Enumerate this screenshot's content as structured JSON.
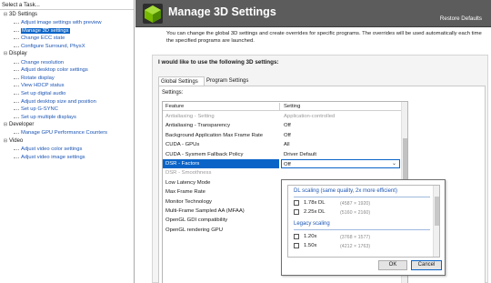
{
  "left_pane": {
    "title": "Select a Task...",
    "categories": [
      {
        "label": "3D Settings",
        "items": [
          {
            "label": "Adjust image settings with preview"
          },
          {
            "label": "Manage 3D settings",
            "selected": true
          },
          {
            "label": "Change ECC state"
          },
          {
            "label": "Configure Surround, PhysX"
          }
        ]
      },
      {
        "label": "Display",
        "items": [
          {
            "label": "Change resolution"
          },
          {
            "label": "Adjust desktop color settings"
          },
          {
            "label": "Rotate display"
          },
          {
            "label": "View HDCP status"
          },
          {
            "label": "Set up digital audio"
          },
          {
            "label": "Adjust desktop size and position"
          },
          {
            "label": "Set up G-SYNC"
          },
          {
            "label": "Set up multiple displays"
          }
        ]
      },
      {
        "label": "Developer",
        "items": [
          {
            "label": "Manage GPU Performance Counters"
          }
        ]
      },
      {
        "label": "Video",
        "items": [
          {
            "label": "Adjust video color settings"
          },
          {
            "label": "Adjust video image settings"
          }
        ]
      }
    ]
  },
  "main": {
    "banner_title": "Manage 3D Settings",
    "restore_defaults": "Restore Defaults",
    "description": "You can change the global 3D settings and create overrides for specific programs. The overrides will be used automatically each time the specified programs are launched.",
    "settings_heading": "I would like to use the following 3D settings:",
    "tabs": [
      {
        "label": "Global Settings"
      },
      {
        "label": "Program Settings"
      }
    ],
    "settings_label": "Settings:",
    "grid": {
      "columns": [
        "Feature",
        "Setting"
      ],
      "rows": [
        {
          "feature": "Antialiasing - Setting",
          "setting": "Application-controlled",
          "dim": true
        },
        {
          "feature": "Antialiasing - Transparency",
          "setting": "Off"
        },
        {
          "feature": "Background Application Max Frame Rate",
          "setting": "Off"
        },
        {
          "feature": "CUDA - GPUs",
          "setting": "All"
        },
        {
          "feature": "CUDA - Sysmem Fallback Policy",
          "setting": "Driver Default"
        },
        {
          "feature": "DSR - Factors",
          "setting": "Off",
          "selected": true
        },
        {
          "feature": "DSR - Smoothness",
          "setting": "",
          "dim": true
        },
        {
          "feature": "Low Latency Mode",
          "setting": ""
        },
        {
          "feature": "Max Frame Rate",
          "setting": ""
        },
        {
          "feature": "Monitor Technology",
          "setting": ""
        },
        {
          "feature": "Multi-Frame Sampled AA (MFAA)",
          "setting": ""
        },
        {
          "feature": "OpenGL GDI compatibility",
          "setting": ""
        },
        {
          "feature": "OpenGL rendering GPU",
          "setting": ""
        }
      ]
    },
    "popup": {
      "group1_label": "DL scaling (same quality, 2x more efficient)",
      "group1_items": [
        {
          "label": "1.78x DL",
          "res": "(4587 × 1920)"
        },
        {
          "label": "2.25x DL",
          "res": "(5160 × 2160)"
        }
      ],
      "group2_label": "Legacy scaling",
      "group2_items": [
        {
          "label": "1.20x",
          "res": "(3768 × 1577)"
        },
        {
          "label": "1.50x",
          "res": "(4212 × 1763)"
        }
      ],
      "ok": "OK",
      "cancel": "Cancel"
    }
  },
  "colors": {
    "banner": "#5c5c5c",
    "selection": "#0a64c8",
    "link": "#1c55b4",
    "nvidia_green": "#76b900"
  }
}
